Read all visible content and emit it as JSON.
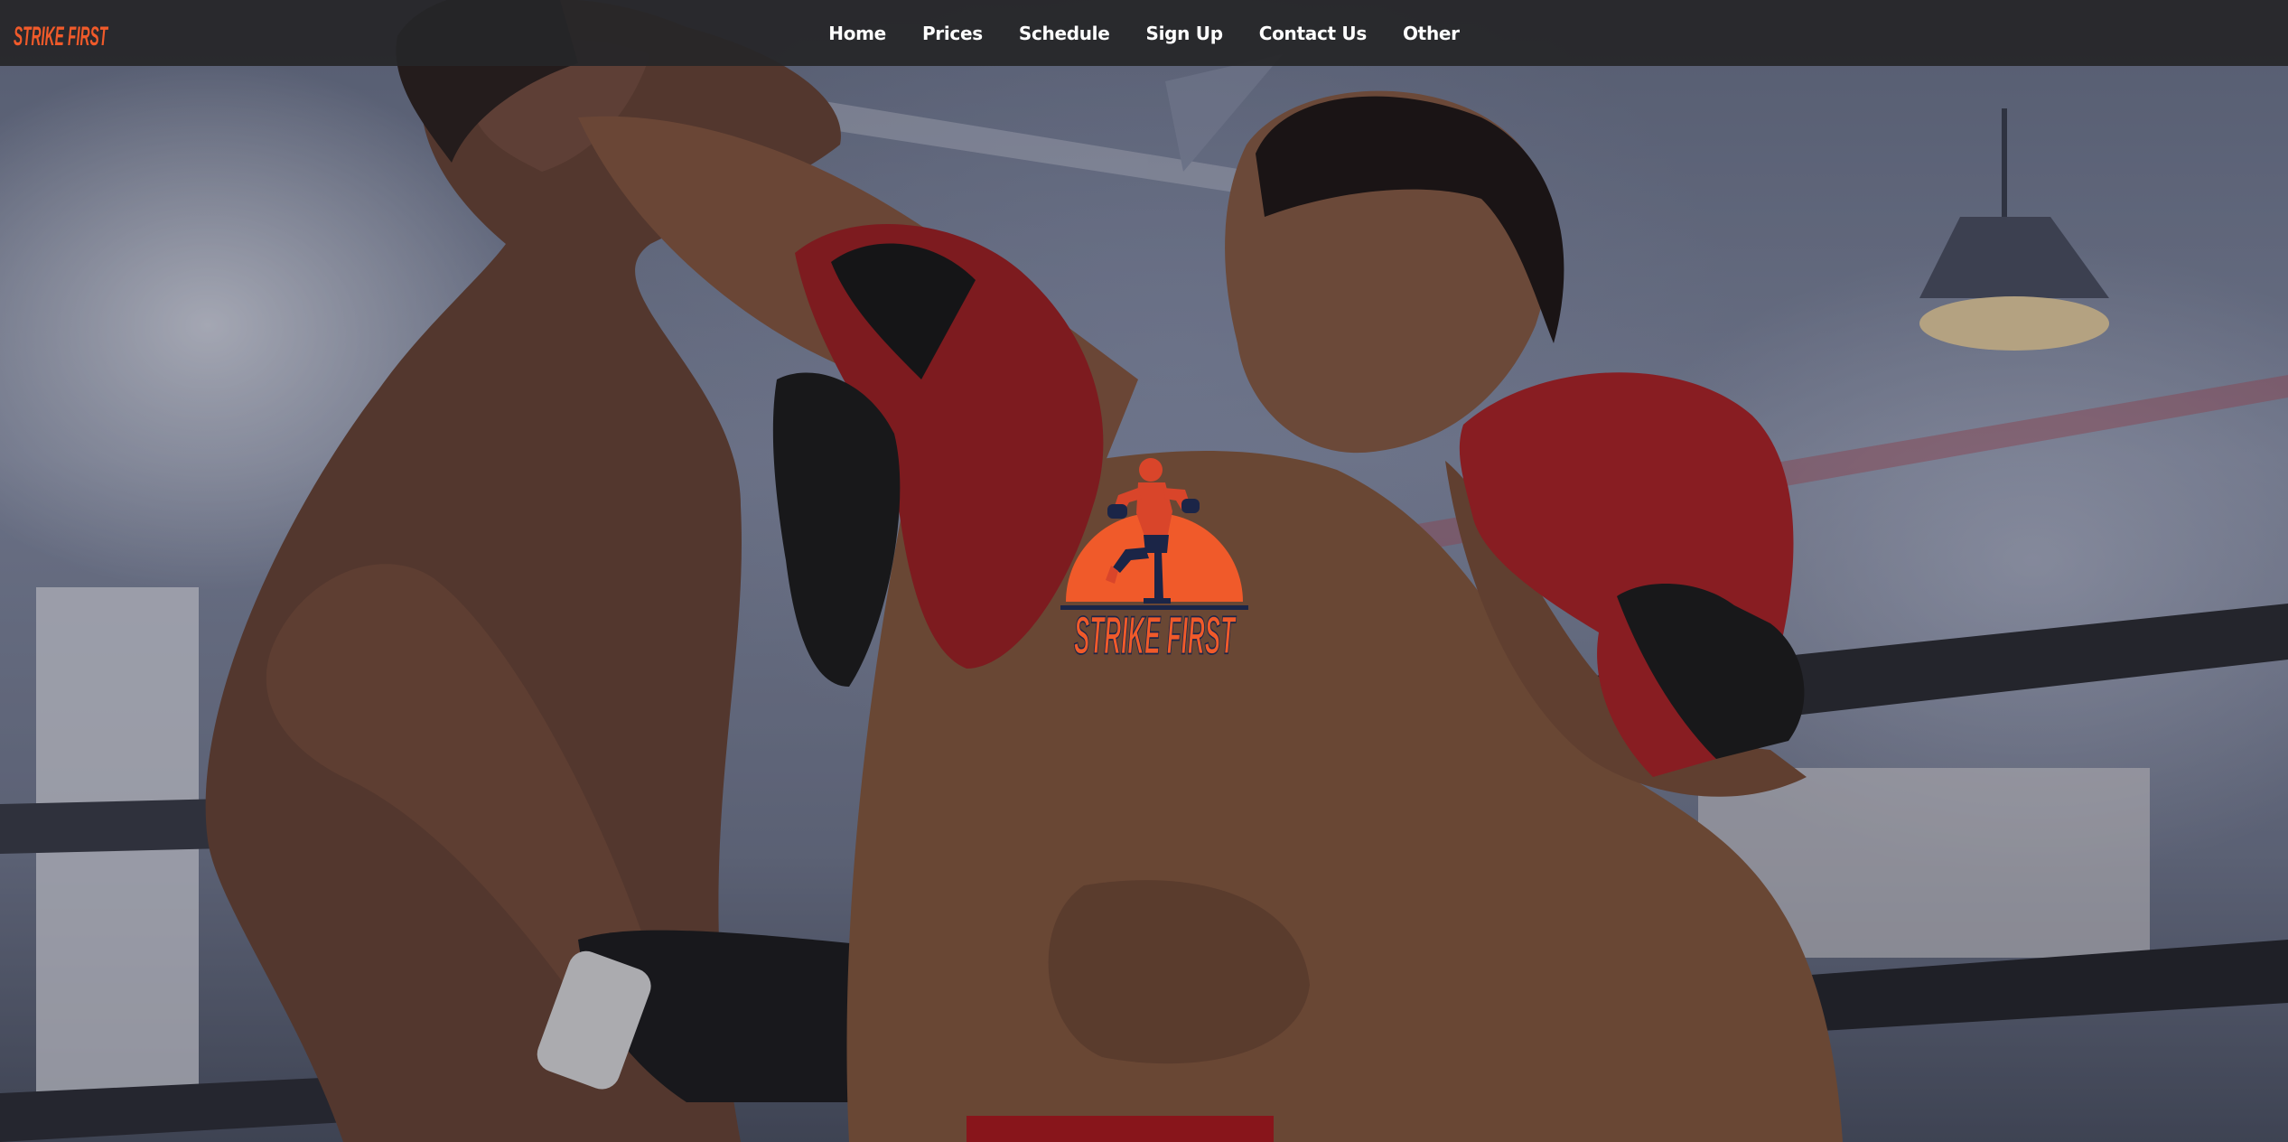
{
  "brand": {
    "name": "STRIKE FIRST",
    "accent_color": "#f05a2a",
    "navy_color": "#1b2547"
  },
  "nav": {
    "items": [
      {
        "label": "Home"
      },
      {
        "label": "Prices"
      },
      {
        "label": "Schedule"
      },
      {
        "label": "Sign Up"
      },
      {
        "label": "Contact Us"
      },
      {
        "label": "Other"
      }
    ]
  },
  "hero": {
    "image_alt": "Two Muay Thai fighters sparring in a boxing ring",
    "logo_text": "STRIKE FIRST"
  }
}
